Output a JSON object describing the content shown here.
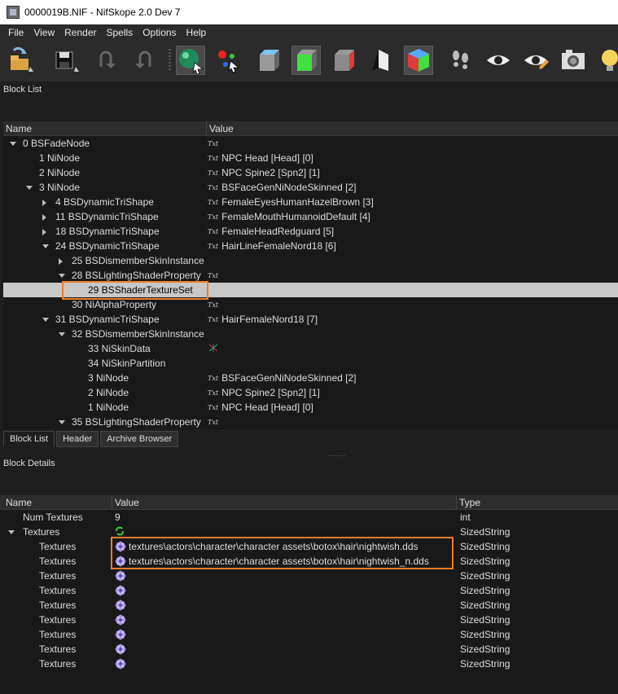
{
  "window": {
    "title": "0000019B.NIF - NifSkope 2.0 Dev 7"
  },
  "menu": [
    "File",
    "View",
    "Render",
    "Spells",
    "Options",
    "Help"
  ],
  "toolbar": {
    "buttons": [
      "load-icon",
      "save-icon",
      "undo-icon",
      "redo-icon",
      "select-object-icon",
      "select-vertex-icon",
      "blue-cube-icon",
      "green-cube-icon",
      "red-cube-icon",
      "wireframe-icon",
      "colored-cube-icon",
      "footprints-icon",
      "eye-icon",
      "eye-edit-icon",
      "screenshot-icon",
      "lightbulb-icon"
    ]
  },
  "block_list": {
    "label": "Block List",
    "columns": {
      "name": "Name",
      "value": "Value"
    },
    "rows": [
      {
        "name": "0 BSFadeNode",
        "value": "",
        "txt": true,
        "indent": 0,
        "arrow": "open"
      },
      {
        "name": "1 NiNode",
        "value": "NPC Head [Head] [0]",
        "txt": true,
        "indent": 1,
        "arrow": ""
      },
      {
        "name": "2 NiNode",
        "value": "NPC Spine2 [Spn2] [1]",
        "txt": true,
        "indent": 1,
        "arrow": ""
      },
      {
        "name": "3 NiNode",
        "value": "BSFaceGenNiNodeSkinned [2]",
        "txt": true,
        "indent": 1,
        "arrow": "open"
      },
      {
        "name": "4 BSDynamicTriShape",
        "value": "FemaleEyesHumanHazelBrown [3]",
        "txt": true,
        "indent": 2,
        "arrow": "closed"
      },
      {
        "name": "11 BSDynamicTriShape",
        "value": "FemaleMouthHumanoidDefault [4]",
        "txt": true,
        "indent": 2,
        "arrow": "closed"
      },
      {
        "name": "18 BSDynamicTriShape",
        "value": "FemaleHeadRedguard [5]",
        "txt": true,
        "indent": 2,
        "arrow": "closed"
      },
      {
        "name": "24 BSDynamicTriShape",
        "value": "HairLineFemaleNord18 [6]",
        "txt": true,
        "indent": 2,
        "arrow": "open"
      },
      {
        "name": "25 BSDismemberSkinInstance",
        "value": "",
        "txt": false,
        "indent": 3,
        "arrow": "closed"
      },
      {
        "name": "28 BSLightingShaderProperty",
        "value": "",
        "txt": true,
        "indent": 3,
        "arrow": "open"
      },
      {
        "name": "29 BSShaderTextureSet",
        "value": "",
        "txt": false,
        "indent": 4,
        "arrow": "",
        "selected": true
      },
      {
        "name": "30 NiAlphaProperty",
        "value": "",
        "txt": true,
        "indent": 3,
        "arrow": ""
      },
      {
        "name": "31 BSDynamicTriShape",
        "value": "HairFemaleNord18 [7]",
        "txt": true,
        "indent": 2,
        "arrow": "open"
      },
      {
        "name": "32 BSDismemberSkinInstance",
        "value": "",
        "txt": false,
        "indent": 3,
        "arrow": "open"
      },
      {
        "name": "33 NiSkinData",
        "value": "",
        "txt": false,
        "axis": true,
        "indent": 4,
        "arrow": ""
      },
      {
        "name": "34 NiSkinPartition",
        "value": "",
        "txt": false,
        "indent": 4,
        "arrow": ""
      },
      {
        "name": "3 NiNode",
        "value": "BSFaceGenNiNodeSkinned [2]",
        "txt": true,
        "indent": 4,
        "arrow": ""
      },
      {
        "name": "2 NiNode",
        "value": "NPC Spine2 [Spn2] [1]",
        "txt": true,
        "indent": 4,
        "arrow": ""
      },
      {
        "name": "1 NiNode",
        "value": "NPC Head [Head] [0]",
        "txt": true,
        "indent": 4,
        "arrow": ""
      },
      {
        "name": "35 BSLightingShaderProperty",
        "value": "",
        "txt": true,
        "indent": 3,
        "arrow": "open"
      }
    ]
  },
  "tabs": [
    "Block List",
    "Header",
    "Archive Browser"
  ],
  "splitter": "......",
  "block_details": {
    "label": "Block Details",
    "columns": {
      "name": "Name",
      "value": "Value",
      "type": "Type"
    },
    "rows": [
      {
        "name": "Num Textures",
        "value": "9",
        "type": "int",
        "indent": 1,
        "arrow": "",
        "icon": ""
      },
      {
        "name": "Textures",
        "value": "",
        "type": "SizedString",
        "indent": 0,
        "arrow": "open",
        "icon": "refresh"
      },
      {
        "name": "Textures",
        "value": "textures\\actors\\character\\character assets\\botox\\hair\\nightwish.dds",
        "type": "SizedString",
        "indent": 2,
        "arrow": "",
        "icon": "flower"
      },
      {
        "name": "Textures",
        "value": "textures\\actors\\character\\character assets\\botox\\hair\\nightwish_n.dds",
        "type": "SizedString",
        "indent": 2,
        "arrow": "",
        "icon": "flower"
      },
      {
        "name": "Textures",
        "value": "",
        "type": "SizedString",
        "indent": 2,
        "arrow": "",
        "icon": "flower"
      },
      {
        "name": "Textures",
        "value": "",
        "type": "SizedString",
        "indent": 2,
        "arrow": "",
        "icon": "flower"
      },
      {
        "name": "Textures",
        "value": "",
        "type": "SizedString",
        "indent": 2,
        "arrow": "",
        "icon": "flower"
      },
      {
        "name": "Textures",
        "value": "",
        "type": "SizedString",
        "indent": 2,
        "arrow": "",
        "icon": "flower"
      },
      {
        "name": "Textures",
        "value": "",
        "type": "SizedString",
        "indent": 2,
        "arrow": "",
        "icon": "flower"
      },
      {
        "name": "Textures",
        "value": "",
        "type": "SizedString",
        "indent": 2,
        "arrow": "",
        "icon": "flower"
      },
      {
        "name": "Textures",
        "value": "",
        "type": "SizedString",
        "indent": 2,
        "arrow": "",
        "icon": "flower"
      }
    ]
  },
  "colors": {
    "highlight": "#f07c2a",
    "selection": "#c8c8c8"
  }
}
